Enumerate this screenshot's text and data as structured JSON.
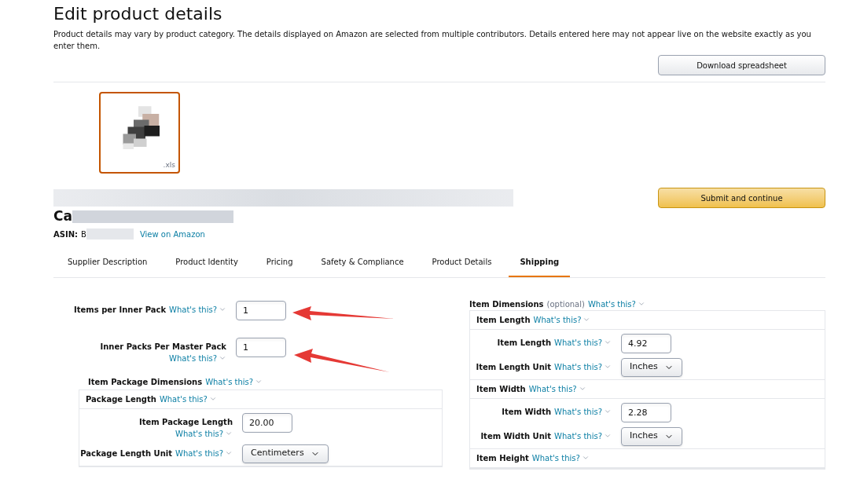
{
  "header": {
    "title": "Edit product details",
    "description": "Product details may vary by product category. The details displayed on Amazon are selected from multiple contributors. Details entered here may not appear live on the website exactly as you enter them.",
    "download_button": "Download spreadsheet"
  },
  "thumbnail": {
    "kind": "picture",
    "file_type": ".xls",
    "selected": true
  },
  "product": {
    "title_visible": "Ca",
    "asin_label": "ASIN:",
    "asin_visible": "B",
    "view_link": "View on Amazon",
    "submit_button": "Submit and continue"
  },
  "tabs": [
    {
      "label": "Supplier Description",
      "selected": false
    },
    {
      "label": "Product Identity",
      "selected": false
    },
    {
      "label": "Pricing",
      "selected": false
    },
    {
      "label": "Safety & Compliance",
      "selected": false
    },
    {
      "label": "Product Details",
      "selected": false
    },
    {
      "label": "Shipping",
      "selected": true
    }
  ],
  "pack_fields": [
    {
      "label": "Items per Inner Pack",
      "help": "What's this?",
      "value": "1"
    },
    {
      "label": "Inner Packs Per Master Pack",
      "help": "What's this?",
      "value": "1"
    }
  ],
  "package_dimensions": {
    "title": "Item Package Dimensions",
    "help": "What's this?",
    "groups": [
      {
        "title": "Package Length",
        "help": "What's this?",
        "fields": [
          {
            "kind": "input",
            "label": "Item Package Length",
            "help": "What's this?",
            "value": "20.00"
          },
          {
            "kind": "select",
            "label": "Package Length Unit",
            "help": "What's this?",
            "value": "Centimeters"
          }
        ]
      }
    ]
  },
  "item_dimensions": {
    "title": "Item Dimensions",
    "note": "(optional)",
    "help": "What's this?",
    "groups": [
      {
        "title": "Item Length",
        "help": "What's this?",
        "fields": [
          {
            "kind": "input",
            "label": "Item Length",
            "help": "What's this?",
            "value": "4.92"
          },
          {
            "kind": "select",
            "label": "Item Length Unit",
            "help": "What's this?",
            "value": "Inches"
          }
        ]
      },
      {
        "title": "Item Width",
        "help": "What's this?",
        "fields": [
          {
            "kind": "input",
            "label": "Item Width",
            "help": "What's this?",
            "value": "2.28"
          },
          {
            "kind": "select",
            "label": "Item Width Unit",
            "help": "What's this?",
            "value": "Inches"
          }
        ]
      },
      {
        "title": "Item Height",
        "help": "What's this?"
      }
    ]
  }
}
